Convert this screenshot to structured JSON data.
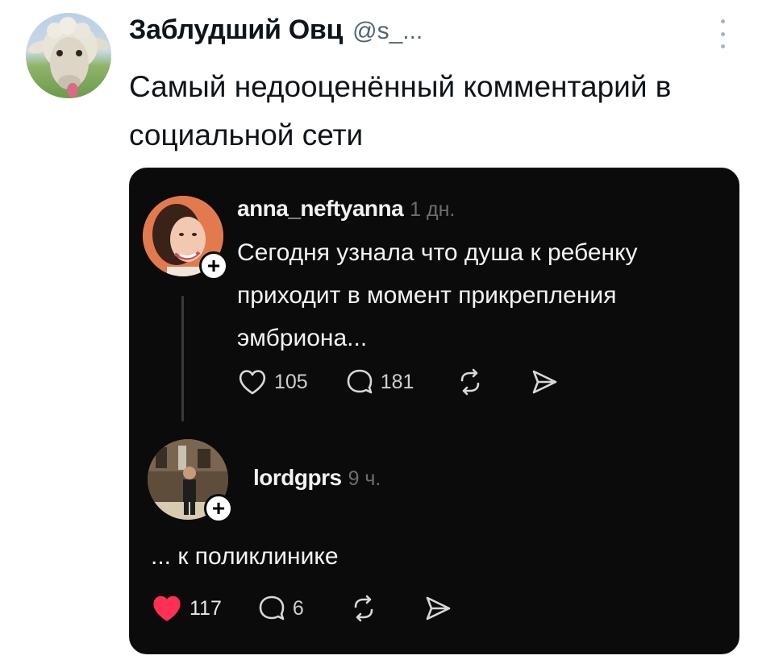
{
  "tweet": {
    "author_name": "Заблудший Овц",
    "author_handle": "@s_...",
    "text": "Самый недооценённый комментарий в социальной сети",
    "icons": {
      "avatar": "sheep-avatar",
      "more": "vertical-ellipsis-icon"
    }
  },
  "embedded": {
    "comments": [
      {
        "username": "anna_neftyanna",
        "time": "1 дн.",
        "text": "Сегодня узнала что душа к ребенку приходит в момент прикрепления эмбриона...",
        "likes": "105",
        "liked": false,
        "replies": "181"
      },
      {
        "username": "lordgprs",
        "time": "9 ч.",
        "text": "... к поликлинике",
        "likes": "117",
        "liked": true,
        "replies": "6"
      }
    ],
    "follow_badge": "+"
  },
  "colors": {
    "card_background": "#0b0b0b",
    "liked_heart": "#ff2f56",
    "handle_gray": "#536471"
  }
}
